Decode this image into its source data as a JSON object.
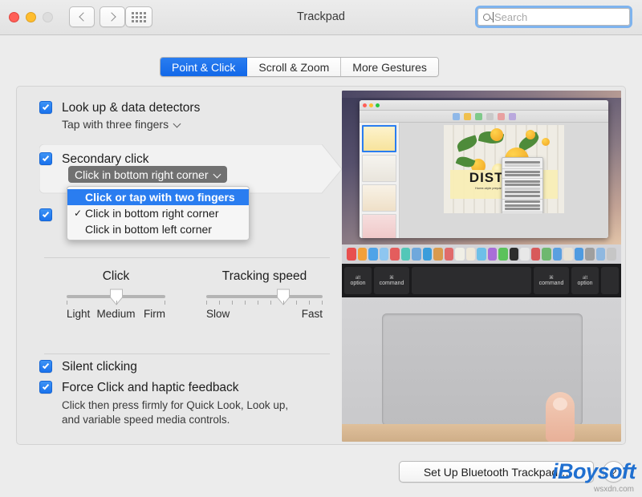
{
  "window": {
    "title": "Trackpad",
    "traffic_lights": [
      "close",
      "minimize",
      "zoom"
    ],
    "nav": {
      "back": "‹",
      "forward": "›",
      "show_all": "show-all-grid"
    },
    "search": {
      "placeholder": "Search",
      "value": ""
    }
  },
  "tabs": [
    {
      "label": "Point & Click",
      "selected": true
    },
    {
      "label": "Scroll & Zoom",
      "selected": false
    },
    {
      "label": "More Gestures",
      "selected": false
    }
  ],
  "options": {
    "lookup": {
      "title": "Look up & data detectors",
      "value": "Tap with three fingers",
      "checked": true
    },
    "secondary_click": {
      "title": "Secondary click",
      "value": "Click in bottom right corner",
      "checked": true,
      "menu": [
        {
          "label": "Click or tap with two fingers",
          "highlighted": true,
          "checked": false
        },
        {
          "label": "Click in bottom right corner",
          "highlighted": false,
          "checked": true
        },
        {
          "label": "Click in bottom left corner",
          "highlighted": false,
          "checked": false
        }
      ]
    },
    "third_option": {
      "checked": true
    }
  },
  "sliders": {
    "click": {
      "title": "Click",
      "labels": [
        "Light",
        "Medium",
        "Firm"
      ],
      "value_percent": 50,
      "tick_count": 3
    },
    "tracking": {
      "title": "Tracking speed",
      "labels": [
        "Slow",
        "Fast"
      ],
      "value_percent": 66,
      "tick_count": 10
    }
  },
  "bottom_checks": [
    {
      "title": "Silent clicking",
      "checked": true,
      "desc": ""
    },
    {
      "title": "Force Click and haptic feedback",
      "checked": true,
      "desc": "Click then press firmly for Quick Look, Look up,\nand variable speed media controls."
    }
  ],
  "demo": {
    "poster_title": "DISTRICT",
    "poster_sub": "Home-style preparations for your kitchen",
    "keys": [
      {
        "top": "alt",
        "label": "option"
      },
      {
        "top": "⌘",
        "label": "command"
      },
      {
        "top": "",
        "label": ""
      },
      {
        "top": "⌘",
        "label": "command"
      },
      {
        "top": "alt",
        "label": "option"
      }
    ]
  },
  "footer": {
    "bluetooth_button": "Set Up Bluetooth Trackpad…",
    "help_button": "?"
  },
  "watermark": {
    "brand": "iBoysoft",
    "sub": "wsxdn.com"
  },
  "colors": {
    "accent": "#2a7df0",
    "checkbox": "#1a72ec",
    "panel_bg": "#e8e8e8",
    "window_bg": "#ececec",
    "popup_active": "#717171"
  }
}
